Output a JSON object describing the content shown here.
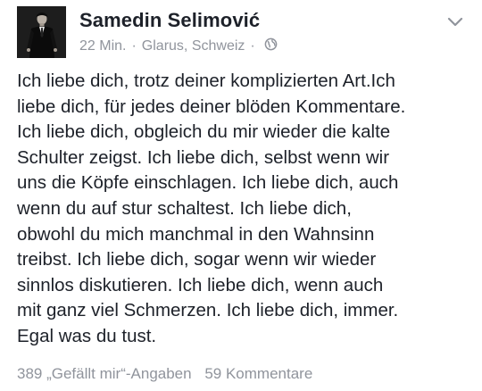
{
  "post": {
    "author": "Samedin Selimović",
    "time": "22 Min.",
    "location": "Glarus, Schweiz",
    "separator": "·",
    "privacy_icon": "globe-icon",
    "menu_icon": "chevron-down-icon",
    "lines": [
      "Ich liebe dich, trotz deiner komplizierten Art.Ich",
      "liebe dich, für jedes deiner blöden Kommentare.",
      "Ich liebe dich, obgleich du mir wieder die kalte",
      "Schulter zeigst. Ich liebe dich, selbst wenn wir",
      "uns die Köpfe einschlagen. Ich liebe dich, auch",
      "wenn du auf stur schaltest. Ich liebe dich,",
      "obwohl du mich manchmal in den Wahnsinn",
      "treibst. Ich liebe dich, sogar wenn wir wieder",
      "sinnlos diskutieren. Ich liebe dich, wenn auch",
      "mit ganz viel Schmerzen. Ich liebe dich, immer.",
      "Egal was du tust."
    ],
    "likes": "389 „Gefällt mir“-Angaben",
    "comments": "59 Kommentare"
  },
  "colors": {
    "text": "#1d2129",
    "meta": "#90949c",
    "avatar_bg": "#1a1a1a"
  }
}
